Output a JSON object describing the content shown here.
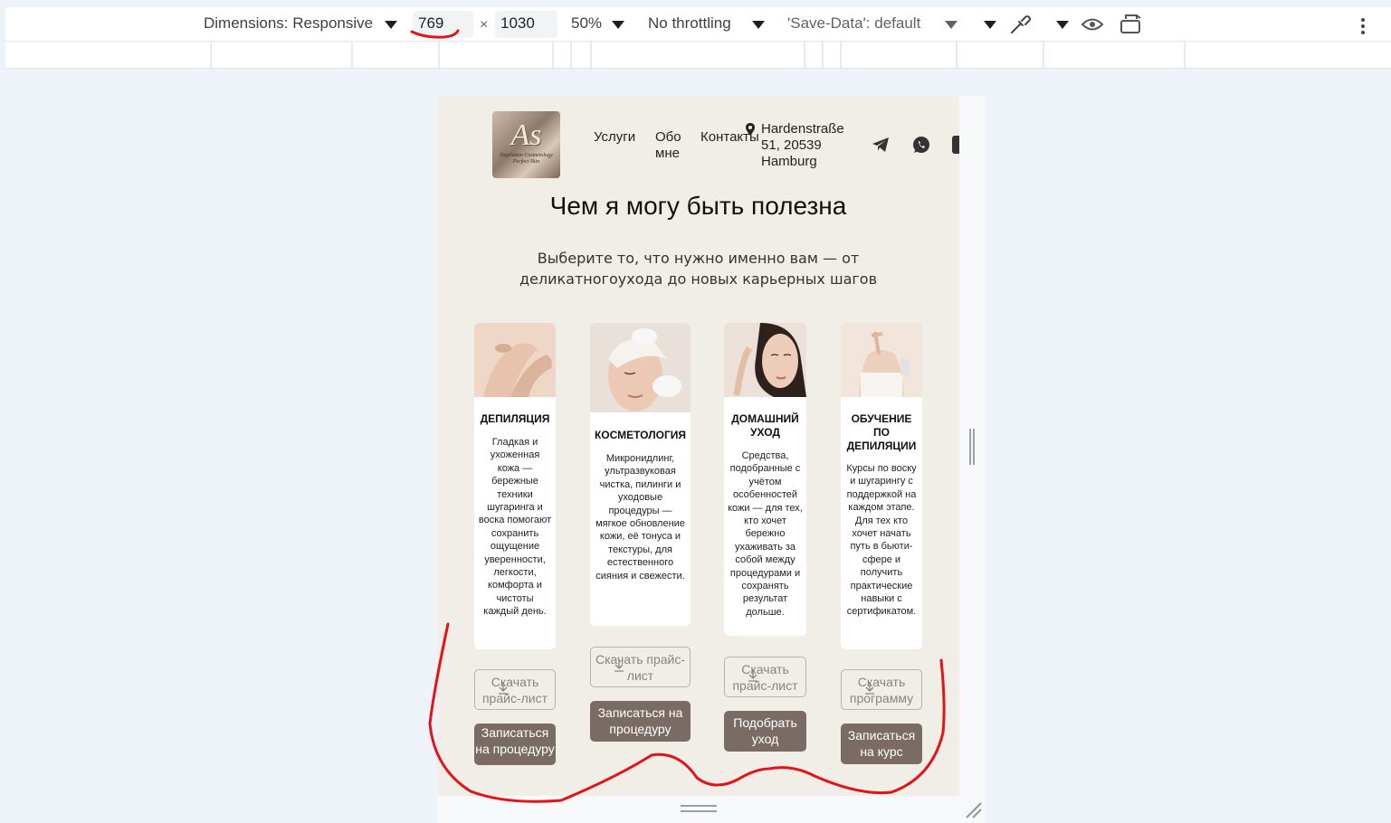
{
  "devtools": {
    "dimensions_label": "Dimensions: Responsive",
    "width_value": "769",
    "times": "×",
    "height_value": "1030",
    "zoom": "50%",
    "throttling": "No throttling",
    "save_data": "'Save-Data': default"
  },
  "site": {
    "logo_mark": "As",
    "logo_sub": "Depilation Cosmetology Perfect Skin",
    "nav": [
      "Услуги",
      "Обо мне",
      "Контакты"
    ],
    "address": "Hardenstraße 51, 20539 Hamburg",
    "title": "Чем я могу быть полезна",
    "subtitle": "Выберите то, что нужно именно вам — от деликатногоухода до новых карьерных шагов"
  },
  "cards": [
    {
      "title": "ДЕПИЛЯЦИЯ",
      "text": "Гладкая и ухоженная кожа — бережные техники шугаринга и воска помогают сохранить ощущение уверенности, легкости, комфорта и чистоты каждый день.",
      "outline_button": "Скачать прайс-лист",
      "fill_button": "Записаться на процедуру"
    },
    {
      "title": "КОСМЕТОЛОГИЯ",
      "text": "Микронидлинг, ультразвуковая чистка, пилинги и уходовые процедуры — мягкое обновление кожи, её тонуса и текстуры, для естественного сияния и свежести.",
      "outline_button": "Скачать прайс-лист",
      "fill_button": "Записаться на процедуру"
    },
    {
      "title": "ДОМАШНИЙ УХОД",
      "text": "Средства, подобранные с учётом особенностей кожи — для тех, кто хочет бережно ухаживать за собой между процедурами и сохранять результат дольше.",
      "outline_button": "Скачать прайс-лист",
      "fill_button": "Подобрать уход"
    },
    {
      "title": "ОБУЧЕНИЕ ПО ДЕПИЛЯЦИИ",
      "text": "Курсы по воску и шугарингу с поддержкой на каждом этапе. Для тех кто хочет начать путь в бьюти-сфере и получить практические навыки с сертификатом.",
      "outline_button": "Скачать программу",
      "fill_button": "Записаться на курс"
    }
  ],
  "colors": {
    "page_bg": "#f1ede7",
    "card_bg": "#ffffff",
    "fill_button": "#7a6c65",
    "annotation": "#e0141b"
  }
}
